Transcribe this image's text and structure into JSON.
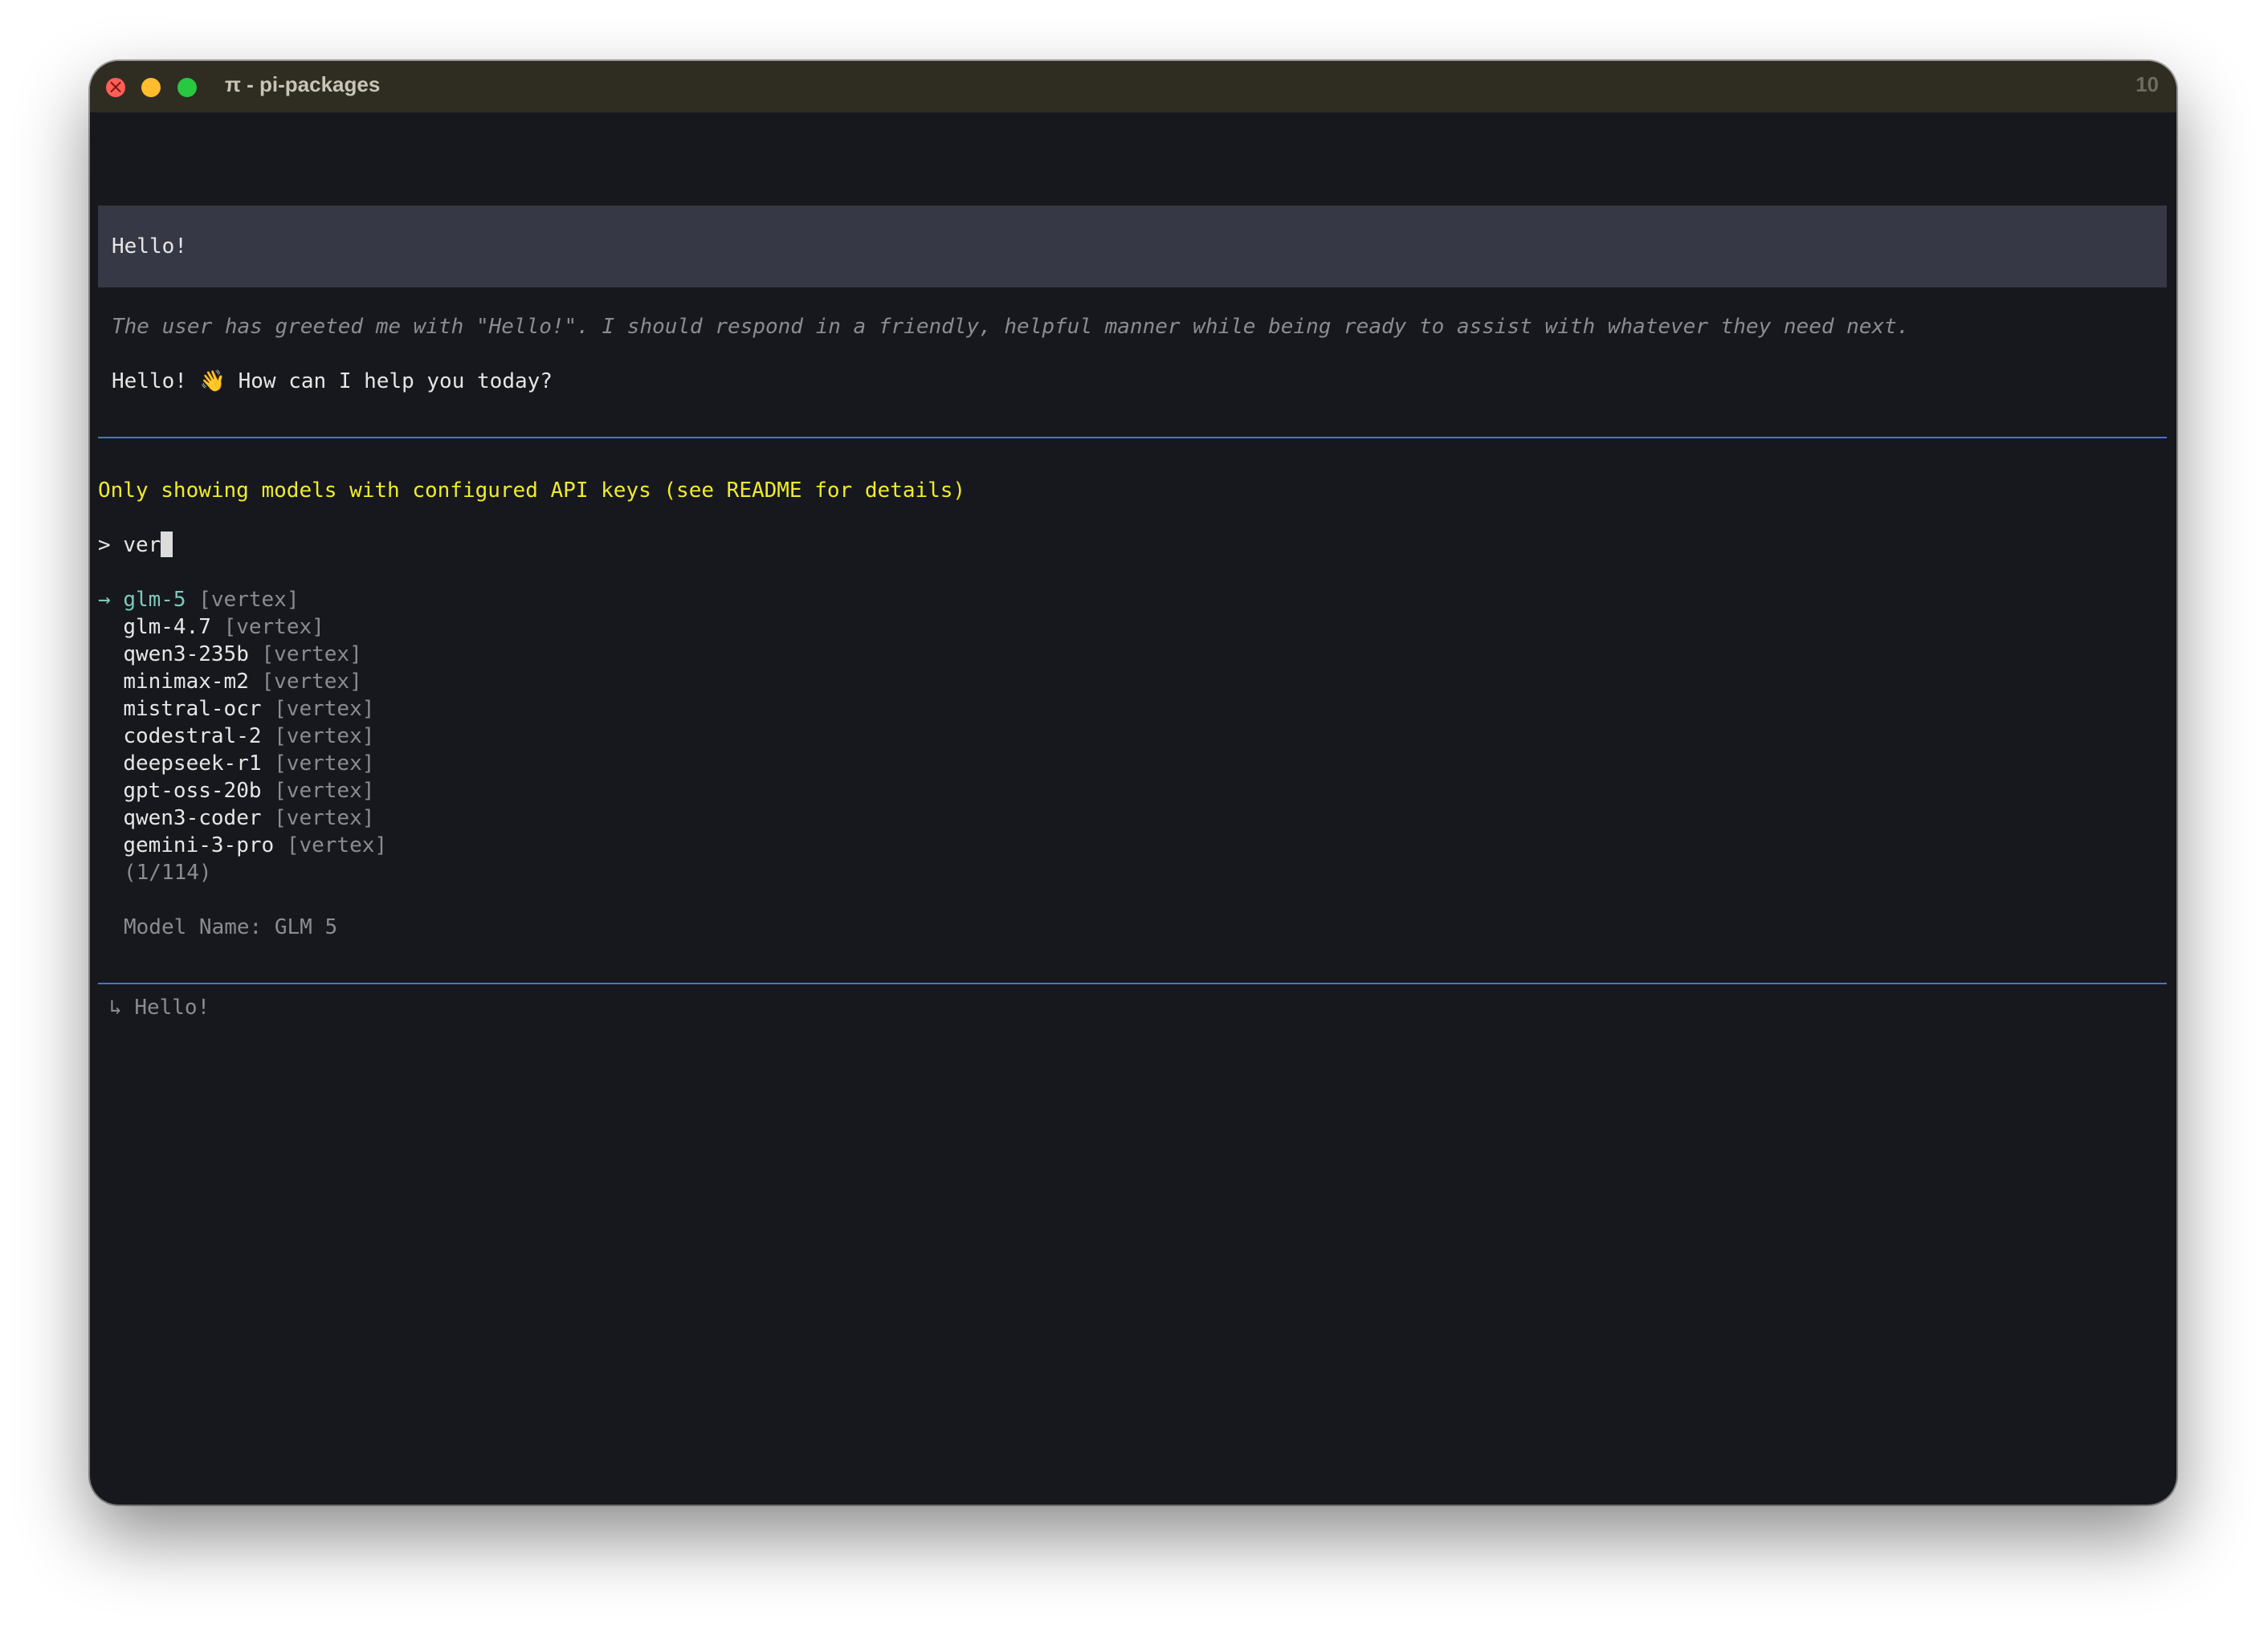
{
  "window": {
    "title": "π - pi-packages",
    "tab_count": "10"
  },
  "conversation": {
    "user_message": "Hello!",
    "thinking": "The user has greeted me with \"Hello!\". I should respond in a friendly, helpful manner while being ready to assist with whatever they need next.",
    "assistant_reply": "Hello! 👋 How can I help you today?"
  },
  "model_selector": {
    "notice": "Only showing models with configured API keys (see README for details)",
    "prompt_symbol": ">",
    "query": "ver",
    "selection_arrow": "→",
    "models": [
      {
        "name": "glm-5",
        "provider": "[vertex]",
        "selected": true
      },
      {
        "name": "glm-4.7",
        "provider": "[vertex]",
        "selected": false
      },
      {
        "name": "qwen3-235b",
        "provider": "[vertex]",
        "selected": false
      },
      {
        "name": "minimax-m2",
        "provider": "[vertex]",
        "selected": false
      },
      {
        "name": "mistral-ocr",
        "provider": "[vertex]",
        "selected": false
      },
      {
        "name": "codestral-2",
        "provider": "[vertex]",
        "selected": false
      },
      {
        "name": "deepseek-r1",
        "provider": "[vertex]",
        "selected": false
      },
      {
        "name": "gpt-oss-20b",
        "provider": "[vertex]",
        "selected": false
      },
      {
        "name": "qwen3-coder",
        "provider": "[vertex]",
        "selected": false
      },
      {
        "name": "gemini-3-pro",
        "provider": "[vertex]",
        "selected": false
      }
    ],
    "pagination": "(1/114)",
    "model_name_label": "Model Name: GLM 5"
  },
  "editor": {
    "queued_symbol": "↳",
    "queued_message": "Hello!"
  },
  "colors": {
    "background": "#16181d",
    "titlebar": "#2f2c22",
    "user_block": "#373845",
    "separator": "#4b6fd8",
    "warning": "#f0eb2c",
    "selected": "#7fc8bb",
    "dim": "#8a8c93"
  }
}
